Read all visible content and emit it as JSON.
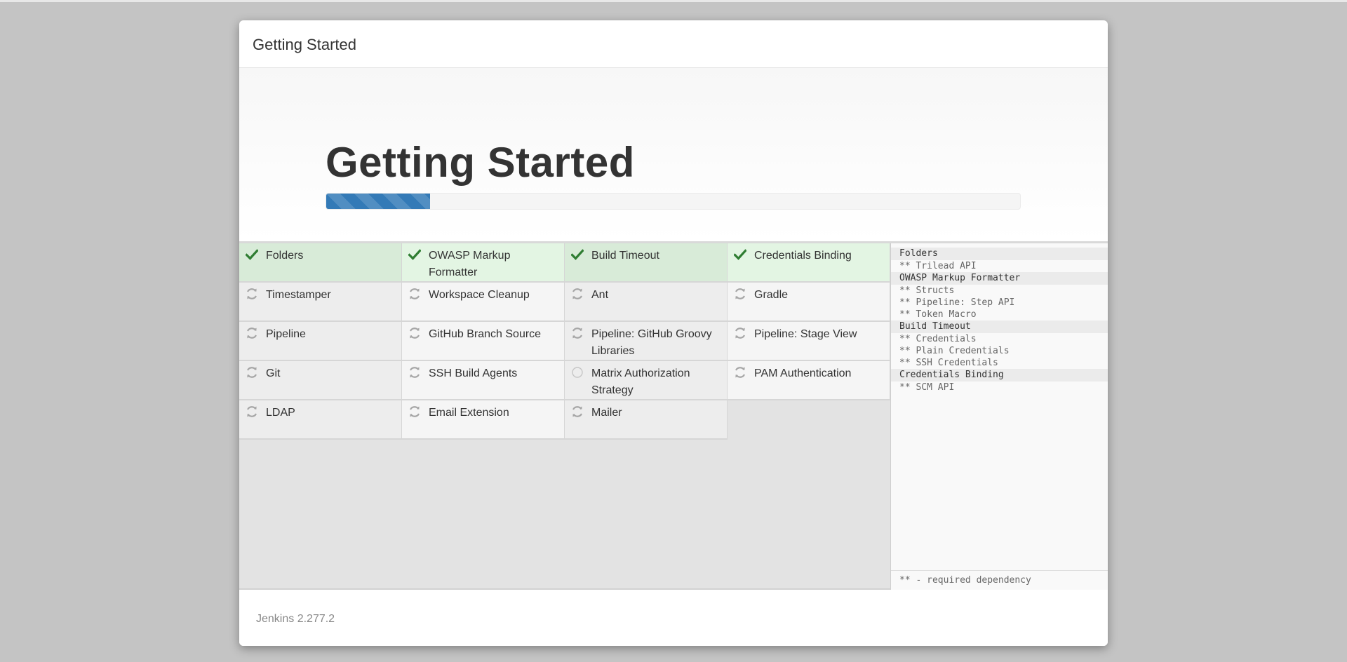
{
  "header": {
    "title": "Getting Started"
  },
  "hero": {
    "heading": "Getting Started",
    "progress_percent": 15
  },
  "plugins": [
    {
      "name": "Folders",
      "status": "success",
      "icon": "checkmark-icon"
    },
    {
      "name": "OWASP Markup Formatter",
      "status": "success",
      "icon": "checkmark-icon"
    },
    {
      "name": "Build Timeout",
      "status": "success",
      "icon": "checkmark-icon"
    },
    {
      "name": "Credentials Binding",
      "status": "success",
      "icon": "checkmark-icon"
    },
    {
      "name": "Timestamper",
      "status": "pending",
      "icon": "refresh-icon"
    },
    {
      "name": "Workspace Cleanup",
      "status": "pending",
      "icon": "refresh-icon"
    },
    {
      "name": "Ant",
      "status": "pending",
      "icon": "refresh-icon"
    },
    {
      "name": "Gradle",
      "status": "pending",
      "icon": "refresh-icon"
    },
    {
      "name": "Pipeline",
      "status": "pending",
      "icon": "refresh-icon"
    },
    {
      "name": "GitHub Branch Source",
      "status": "pending",
      "icon": "refresh-icon"
    },
    {
      "name": "Pipeline: GitHub Groovy Libraries",
      "status": "pending",
      "icon": "refresh-icon"
    },
    {
      "name": "Pipeline: Stage View",
      "status": "pending",
      "icon": "refresh-icon"
    },
    {
      "name": "Git",
      "status": "pending",
      "icon": "refresh-icon"
    },
    {
      "name": "SSH Build Agents",
      "status": "pending",
      "icon": "refresh-icon"
    },
    {
      "name": "Matrix Authorization Strategy",
      "status": "queued",
      "icon": "circle-icon"
    },
    {
      "name": "PAM Authentication",
      "status": "pending",
      "icon": "refresh-icon"
    },
    {
      "name": "LDAP",
      "status": "pending",
      "icon": "refresh-icon"
    },
    {
      "name": "Email Extension",
      "status": "pending",
      "icon": "refresh-icon"
    },
    {
      "name": "Mailer",
      "status": "pending",
      "icon": "refresh-icon"
    }
  ],
  "dependencies": [
    {
      "title": "Folders",
      "items": [
        "** Trilead API"
      ]
    },
    {
      "title": "OWASP Markup Formatter",
      "items": [
        "** Structs",
        "** Pipeline: Step API",
        "** Token Macro"
      ]
    },
    {
      "title": "Build Timeout",
      "items": [
        "** Credentials",
        "** Plain Credentials",
        "** SSH Credentials"
      ]
    },
    {
      "title": "Credentials Binding",
      "items": [
        "** SCM API"
      ]
    }
  ],
  "legend": "** - required dependency",
  "footer": {
    "version": "Jenkins 2.277.2"
  },
  "colors": {
    "success": "#2f7d32",
    "pending_icon": "#a6a6a6",
    "progress": "#337ab7"
  }
}
